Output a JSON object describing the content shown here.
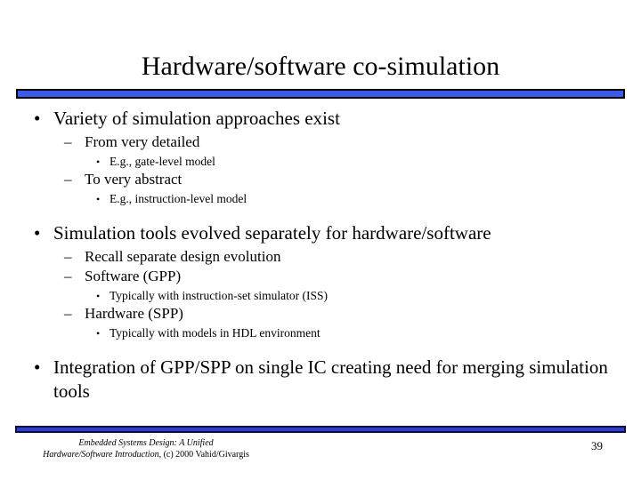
{
  "slide": {
    "title": "Hardware/software co-simulation",
    "page_number": "39",
    "accent_color_top_bar": "#3a5ae8",
    "accent_color_bottom_bar": "#2b3fd0",
    "background_color": "#ffffff",
    "text_color": "#000000"
  },
  "markers": {
    "level1": "•",
    "level2": "–",
    "level3": "•"
  },
  "content": {
    "items": [
      {
        "level": 1,
        "text": "Variety of simulation approaches exist"
      },
      {
        "level": 2,
        "text": "From very detailed"
      },
      {
        "level": 3,
        "text": "E.g., gate-level model"
      },
      {
        "level": 2,
        "text": "To very abstract"
      },
      {
        "level": 3,
        "text": "E.g., instruction-level model"
      },
      {
        "level": 1,
        "text": "Simulation tools evolved separately for hardware/software"
      },
      {
        "level": 2,
        "text": "Recall separate design evolution"
      },
      {
        "level": 2,
        "text": "Software (GPP)"
      },
      {
        "level": 3,
        "text": "Typically with instruction-set simulator (ISS)"
      },
      {
        "level": 2,
        "text": "Hardware (SPP)"
      },
      {
        "level": 3,
        "text": "Typically with models in HDL environment"
      },
      {
        "level": 1,
        "text": "Integration of GPP/SPP on single IC creating need for merging simulation tools"
      }
    ]
  },
  "footer": {
    "citation_line1": "Embedded Systems Design: A Unified",
    "citation_line2": "Hardware/Software Introduction,",
    "copyright": " (c) 2000 Vahid/Givargis"
  }
}
